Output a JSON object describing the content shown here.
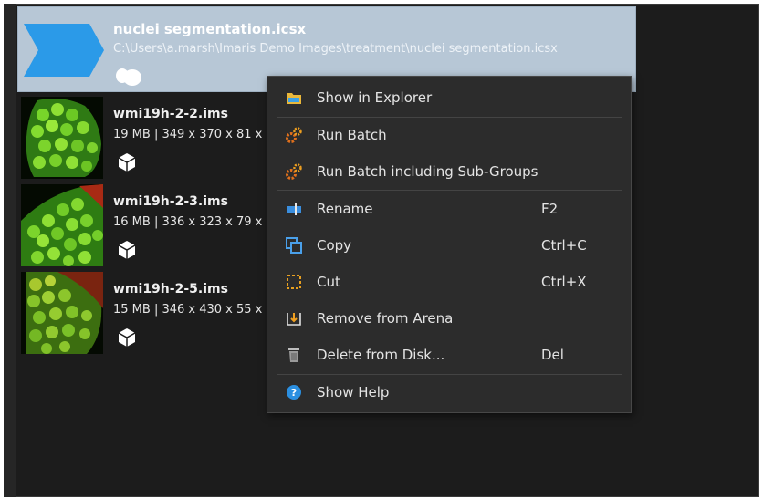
{
  "group": {
    "title": "nuclei segmentation.icsx",
    "path": "C:\\Users\\a.marsh\\Imaris Demo Images\\treatment\\nuclei segmentation.icsx",
    "icon": "cells-icon"
  },
  "files": [
    {
      "name": "wmi19h-2-2.ims",
      "meta": "19 MB | 349 x 370 x 81 x",
      "icon": "cube-icon"
    },
    {
      "name": "wmi19h-2-3.ims",
      "meta": "16 MB | 336 x 323 x 79 x",
      "icon": "cube-icon"
    },
    {
      "name": "wmi19h-2-5.ims",
      "meta": "15 MB | 346 x 430 x 55 x",
      "icon": "cube-icon"
    }
  ],
  "context_menu": {
    "items": [
      {
        "label": "Show in Explorer",
        "shortcut": "",
        "icon": "folder-icon"
      },
      {
        "label": "Run Batch",
        "shortcut": "",
        "icon": "gears-icon"
      },
      {
        "label": "Run Batch including Sub-Groups",
        "shortcut": "",
        "icon": "gears-icon"
      },
      {
        "label": "Rename",
        "shortcut": "F2",
        "icon": "rename-icon"
      },
      {
        "label": "Copy",
        "shortcut": "Ctrl+C",
        "icon": "copy-icon"
      },
      {
        "label": "Cut",
        "shortcut": "Ctrl+X",
        "icon": "cut-icon"
      },
      {
        "label": "Remove from Arena",
        "shortcut": "",
        "icon": "remove-icon"
      },
      {
        "label": "Delete from Disk...",
        "shortcut": "Del",
        "icon": "trash-icon"
      },
      {
        "label": "Show Help",
        "shortcut": "",
        "icon": "help-icon"
      }
    ]
  },
  "colors": {
    "selection": "#b7c7d6",
    "background": "#1c1c1c",
    "menu_background": "#2c2c2c",
    "accent_blue": "#2b9ae8"
  }
}
